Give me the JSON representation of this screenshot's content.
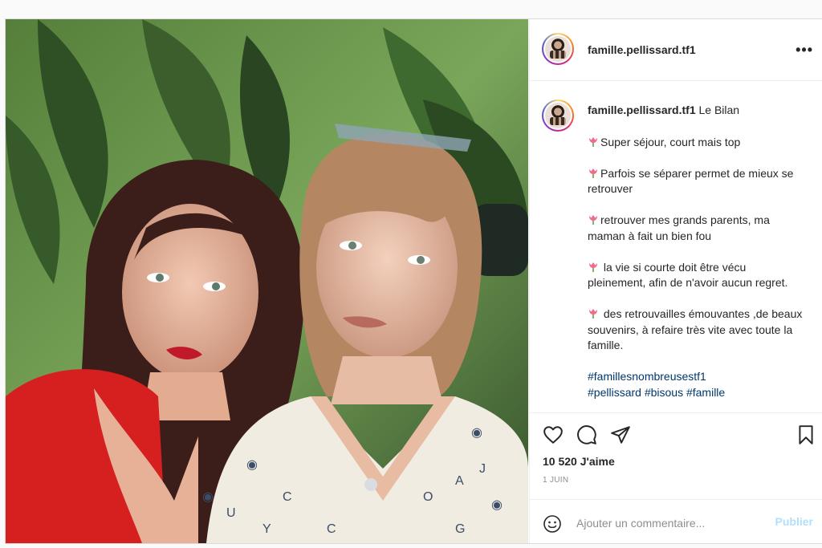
{
  "post": {
    "username": "famille.pellissard.tf1",
    "more_label": "•••",
    "caption": {
      "username": "famille.pellissard.tf1",
      "title": "Le Bilan",
      "lines": [
        "Super séjour, court mais top",
        "Parfois se séparer permet de mieux se retrouver",
        "retrouver mes grands parents, ma maman à fait un bien fou",
        " la vie si courte doit être vécu pleinement, afin de n'avoir aucun regret.",
        " des retrouvailles émouvantes ,de beaux souvenirs, à refaire très vite avec toute la famille."
      ],
      "hashtag": "#famillesnombreusestf1",
      "hashtag_cut": "#pellissard #bisous #famille"
    },
    "likes": "10 520 J'aime",
    "date": "1 JUIN",
    "comment_placeholder": "Ajouter un commentaire...",
    "publish_label": "Publier"
  },
  "icons": [
    "heart-icon",
    "comment-icon",
    "share-icon",
    "bookmark-icon",
    "emoji-icon",
    "tulip-icon"
  ],
  "colors": {
    "link": "#00376b",
    "publish_disabled": "#b2dffc",
    "muted": "#8e8e8e",
    "tulip": "#f26a8d"
  }
}
